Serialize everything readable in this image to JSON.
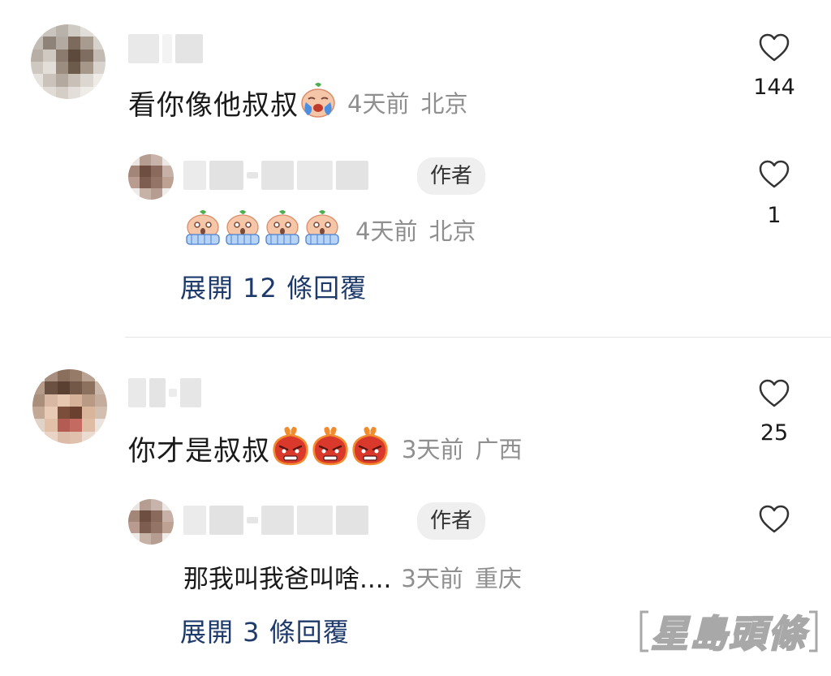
{
  "comments": [
    {
      "text": "看你像他叔叔",
      "emoji": "crying-face-emoji",
      "time": "4天前",
      "location": "北京",
      "likes": "144",
      "reply": {
        "tag": "作者",
        "emoji": "shocked-face-emoji",
        "time": "4天前",
        "location": "北京",
        "likes": "1"
      },
      "expand": "展開 12 條回覆"
    },
    {
      "text": "你才是叔叔",
      "emoji": "angry-face-emoji",
      "time": "3天前",
      "location": "广西",
      "likes": "25",
      "reply": {
        "tag": "作者",
        "text": "那我叫我爸叫啥....",
        "time": "3天前",
        "location": "重庆",
        "likes": ""
      },
      "expand": "展開 3 條回覆"
    }
  ],
  "watermark": "星島頭條",
  "colors": {
    "link": "#1e3a6b",
    "meta": "#8f8f8f",
    "divider": "#e5e5e5"
  }
}
